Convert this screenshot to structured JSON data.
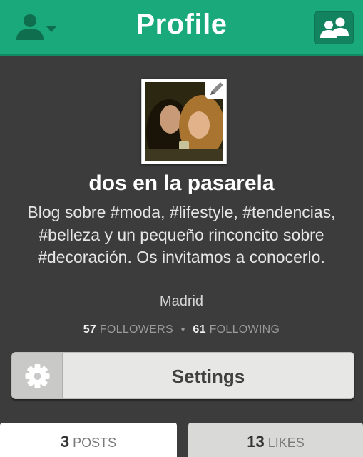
{
  "header": {
    "title": "Profile",
    "bg_color": "#19a97a",
    "left_icon": "account-menu-icon",
    "right_icon": "find-people-icon"
  },
  "profile": {
    "name": "dos en la pasarela",
    "bio": "Blog sobre #moda, #lifestyle, #tendencias, #belleza y un pequeño rinconcito sobre #decoración. Os invitamos a conocerlo.",
    "location": "Madrid",
    "followers_count": "57",
    "followers_label": "FOLLOWERS",
    "following_count": "61",
    "following_label": "FOLLOWING",
    "separator": "•"
  },
  "settings": {
    "label": "Settings",
    "icon": "gear-icon"
  },
  "tabs": [
    {
      "count": "3",
      "label": "POSTS",
      "active": true
    },
    {
      "count": "13",
      "label": "LIKES",
      "active": false
    }
  ]
}
